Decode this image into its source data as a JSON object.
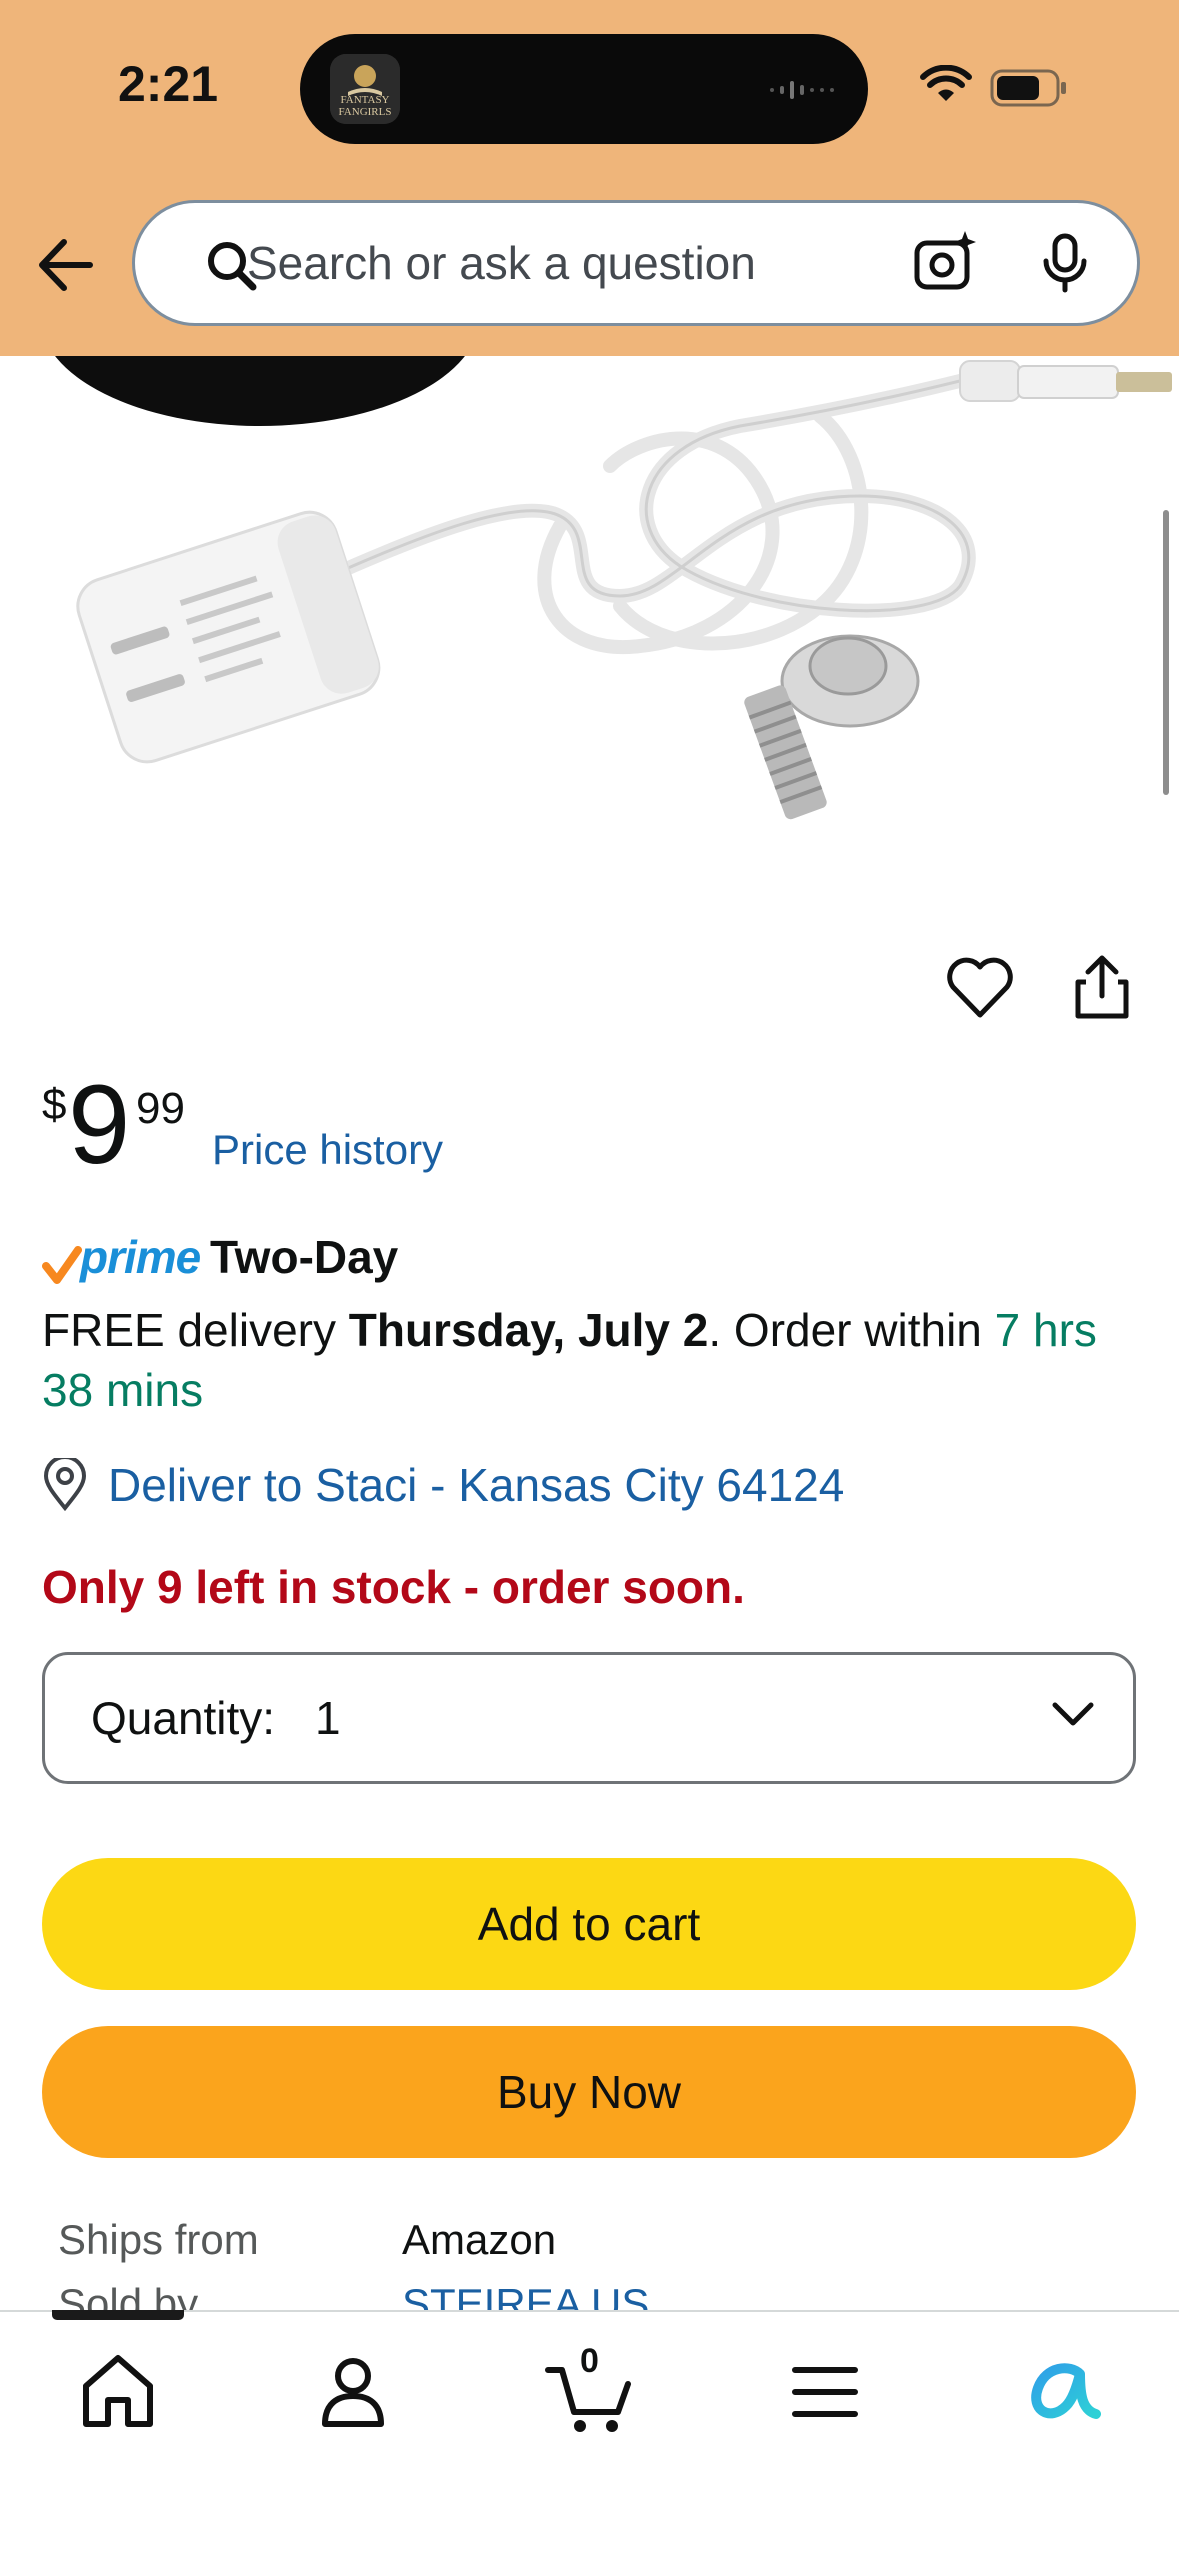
{
  "status_bar": {
    "time": "2:21"
  },
  "dynamic_island": {
    "app_label": "FANTASY FANGIRLS"
  },
  "search": {
    "placeholder": "Search or ask a question"
  },
  "price": {
    "currency": "$",
    "whole": "9",
    "fraction": "99",
    "history_link": "Price history"
  },
  "prime": {
    "brand": "prime",
    "label": "Two-Day"
  },
  "delivery": {
    "prefix": "FREE delivery ",
    "date": "Thursday, July 2",
    "middle": ". Order within ",
    "countdown": "7 hrs 38 mins"
  },
  "deliver_to": {
    "text": "Deliver to Staci - Kansas City 64124"
  },
  "stock": {
    "text": "Only 9 left in stock - order soon."
  },
  "quantity": {
    "label": "Quantity:",
    "value": "1"
  },
  "buttons": {
    "add_to_cart": "Add to cart",
    "buy_now": "Buy Now"
  },
  "seller_info": {
    "ships_from_label": "Ships from",
    "ships_from_value": "Amazon",
    "sold_by_label": "Sold by",
    "sold_by_value": "STEIREA US"
  },
  "bottom_nav": {
    "cart_count": "0"
  },
  "colors": {
    "header_bg": "#efb57a",
    "link": "#1a5fa2",
    "green": "#067d62",
    "stock_red": "#b30818",
    "add_to_cart": "#fcd814",
    "buy_now": "#fba41c",
    "prime_blue": "#1a8fd8"
  }
}
